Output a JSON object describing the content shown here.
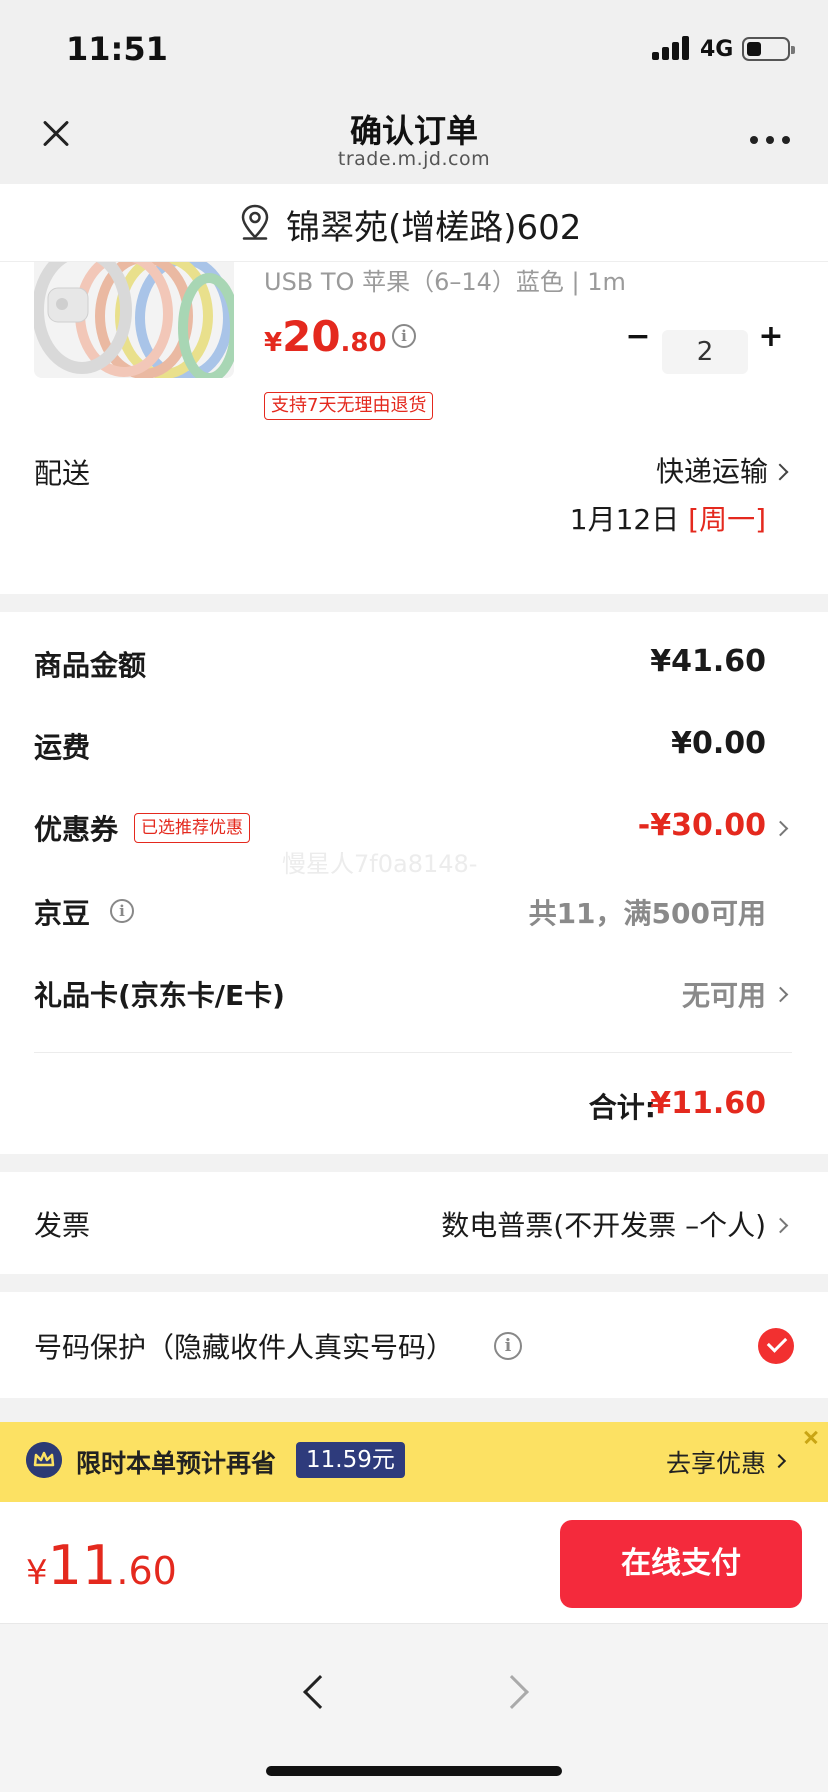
{
  "status_bar": {
    "time": "11:51",
    "network": "4G"
  },
  "nav": {
    "title": "确认订单",
    "subtitle": "trade.m.jd.com"
  },
  "address": {
    "text": "锦翠苑(增槎路)602"
  },
  "product": {
    "spec": "USB TO 苹果（6–14）蓝色 | 1m",
    "price": {
      "symbol": "¥",
      "integer": "20",
      "decimal": ".80"
    },
    "quantity": {
      "minus": "−",
      "value": "2",
      "plus": "+"
    },
    "return_badge": "支持7天无理由退货",
    "delivery": {
      "label": "配送",
      "method": "快递运输",
      "date": "1月12日",
      "weekday": "[周一]"
    }
  },
  "amounts": {
    "goods": {
      "label": "商品金额",
      "value": "¥41.60"
    },
    "shipping": {
      "label": "运费",
      "value": "¥0.00"
    },
    "coupon": {
      "label": "优惠券",
      "badge": "已选推荐优惠",
      "value": "-¥30.00"
    },
    "beans": {
      "label": "京豆",
      "value": "共11，满500可用"
    },
    "giftcard": {
      "label": "礼品卡(京东卡/E卡)",
      "value": "无可用"
    },
    "watermark": "慢星人7f0a8148-",
    "total": {
      "label": "合计:",
      "value": "¥11.60"
    }
  },
  "invoice": {
    "label": "发票",
    "value": "数电普票(不开发票 –个人)"
  },
  "privacy": {
    "label": "号码保护（隐藏收件人真实号码）",
    "checked": true
  },
  "promo": {
    "text": "限时本单预计再省",
    "amount": "11.59元",
    "cta": "去享优惠"
  },
  "pay": {
    "price": {
      "symbol": "¥",
      "integer": "11",
      "decimal": ".60"
    },
    "button": "在线支付"
  },
  "colors": {
    "accent_red": "#e4291e",
    "pay_button": "#f42a3c",
    "promo_yellow": "#fce163",
    "promo_navy": "#2e3b7c"
  },
  "icons": [
    "close-icon",
    "more-icon",
    "location-pin-icon",
    "info-icon",
    "chevron-right-icon",
    "check-circle-icon",
    "crown-icon",
    "back-arrow-icon",
    "forward-arrow-icon"
  ]
}
